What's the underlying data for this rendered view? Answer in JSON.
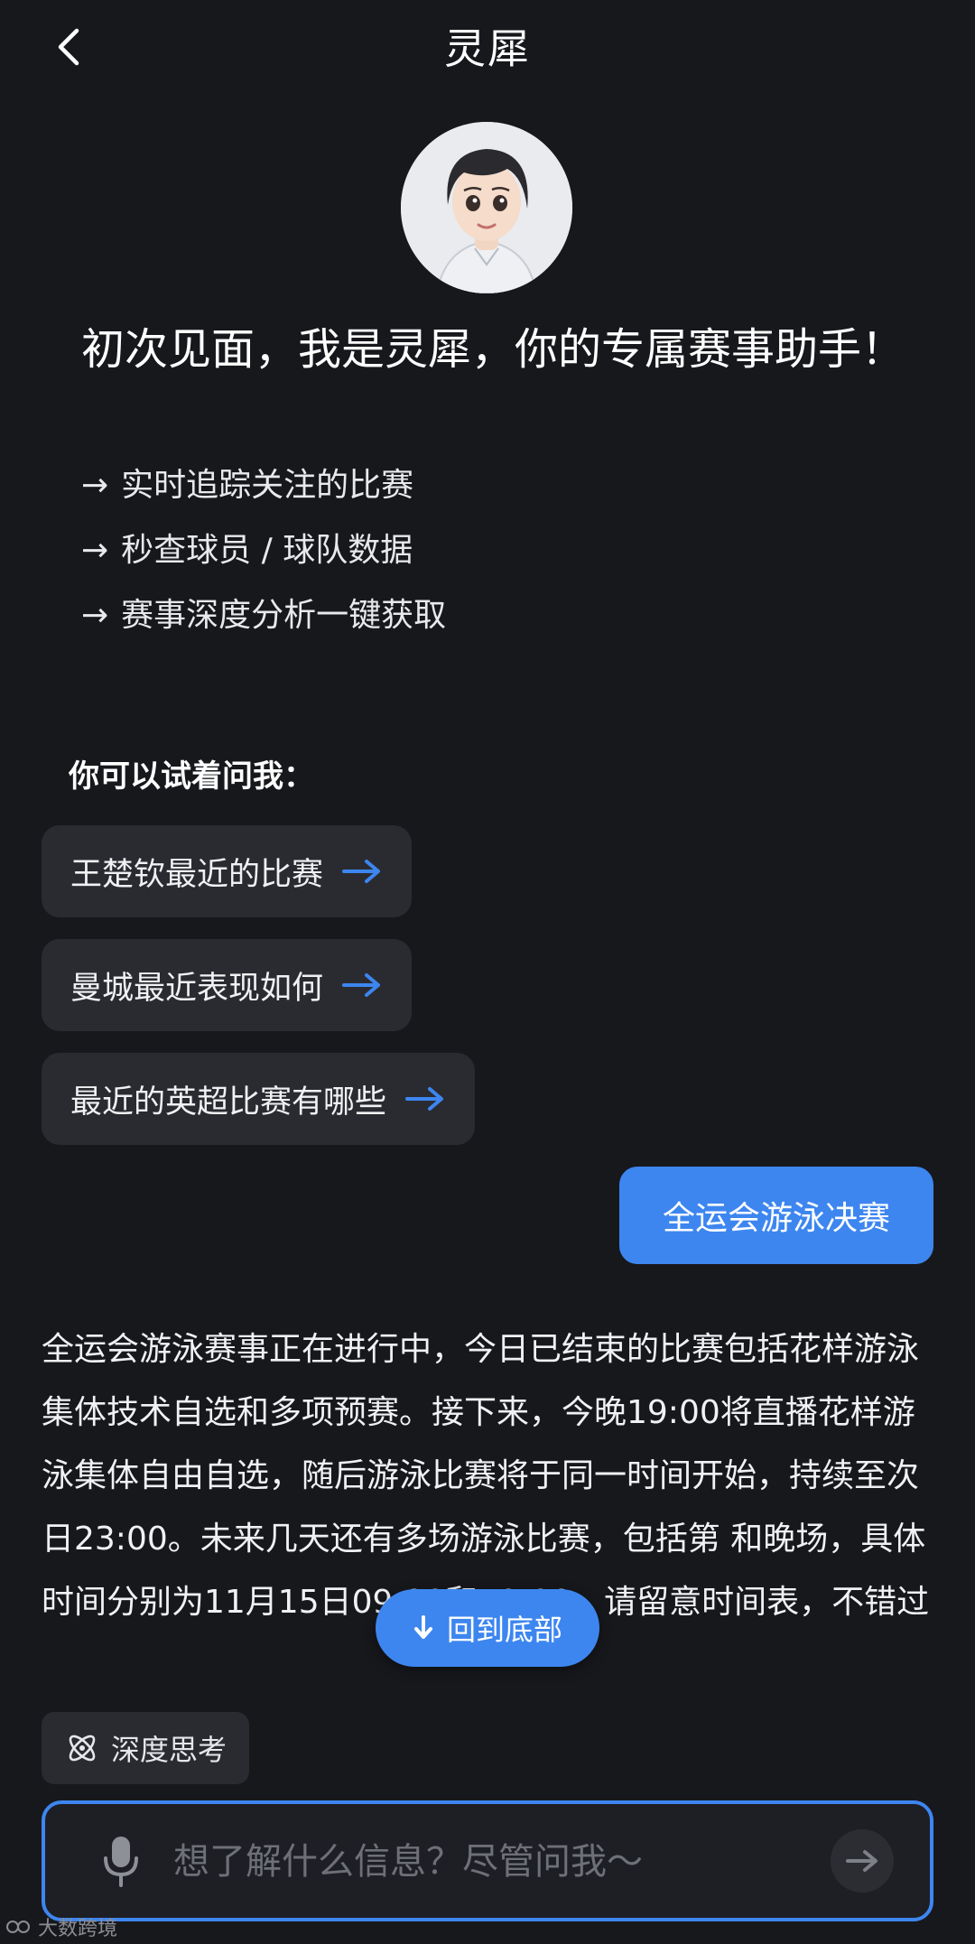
{
  "header": {
    "title": "灵犀",
    "back_icon": "chevron-left-icon"
  },
  "intro": {
    "greeting": "初次见面，我是灵犀，你的专属赛事助手！",
    "features": [
      {
        "arrow": "→",
        "text": "实时追踪关注的比赛"
      },
      {
        "arrow": "→",
        "text": "秒查球员 / 球队数据"
      },
      {
        "arrow": "→",
        "text": "赛事深度分析一键获取"
      }
    ]
  },
  "suggestions": {
    "title": "你可以试着问我：",
    "items": [
      {
        "label": "王楚钦最近的比赛"
      },
      {
        "label": "曼城最近表现如何"
      },
      {
        "label": "最近的英超比赛有哪些"
      }
    ],
    "arrow_color": "#3d86f0"
  },
  "chat": {
    "user_message": "全运会游泳决赛",
    "assistant_message": "全运会游泳赛事正在进行中，今日已结束的比赛包括花样游泳集体技术自选和多项预赛。接下来，今晚19:00将直播花样游泳集体自由自选，随后游泳比赛将于同一时间开始，持续至次日23:00。未来几天还有多场游泳比赛，包括第     和晚场，具体时间分别为11月15日09:00和19:00，请留意时间表，不错过"
  },
  "scroll_bottom": {
    "label": "回到底部"
  },
  "deep_think": {
    "label": "深度思考"
  },
  "input": {
    "placeholder": "想了解什么信息？尽管问我～",
    "value": ""
  },
  "watermark": {
    "text": "大数跨境"
  },
  "colors": {
    "accent": "#3d86f0",
    "background": "#17181c",
    "chip": "#2a2b31"
  }
}
